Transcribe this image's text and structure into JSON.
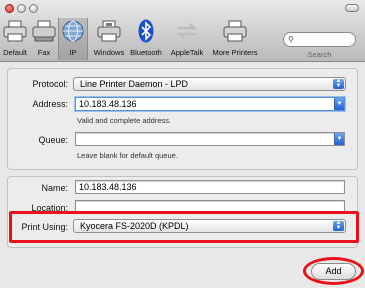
{
  "toolbar": {
    "items": [
      {
        "label": "Default",
        "icon": "printer-default-icon"
      },
      {
        "label": "Fax",
        "icon": "fax-icon"
      },
      {
        "label": "IP",
        "icon": "ip-globe-icon",
        "selected": true
      },
      {
        "label": "Windows",
        "icon": "windows-printer-icon"
      },
      {
        "label": "Bluetooth",
        "icon": "bluetooth-icon"
      },
      {
        "label": "AppleTalk",
        "icon": "appletalk-icon"
      },
      {
        "label": "More Printers",
        "icon": "more-printers-icon"
      }
    ],
    "search_label": "Search",
    "search_value": ""
  },
  "connection": {
    "protocol_label": "Protocol:",
    "protocol_value": "Line Printer Daemon - LPD",
    "address_label": "Address:",
    "address_value": "10.183.48.136",
    "address_hint": "Valid and complete address.",
    "queue_label": "Queue:",
    "queue_value": "",
    "queue_hint": "Leave blank for default queue."
  },
  "details": {
    "name_label": "Name:",
    "name_value": "10.183.48.136",
    "location_label": "Location:",
    "location_value": "",
    "print_using_label": "Print Using:",
    "print_using_value": "Kyocera FS-2020D (KPDL)"
  },
  "actions": {
    "add_label": "Add"
  },
  "colors": {
    "highlight": "#e8121a",
    "accent": "#1f63d6"
  }
}
